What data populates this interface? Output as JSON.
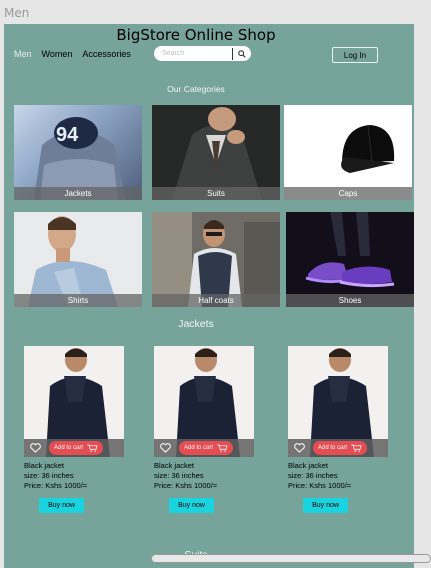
{
  "frame_label": "Men",
  "shop_title": "BigStore Online Shop",
  "nav": {
    "items": [
      "Men",
      "Women",
      "Accessories"
    ]
  },
  "search": {
    "placeholder": "Search"
  },
  "login_label": "Log In",
  "categories_title": "Our Categories",
  "categories": [
    "Jackets",
    "Suits",
    "Caps",
    "Shirts",
    "Half coats",
    "Shoes"
  ],
  "jackets_title": "Jackets",
  "products": [
    {
      "name": "Black jacket",
      "size": "size: 36 inches",
      "price": "Price: Kshs 1000/=",
      "cart_label": "Add to cart",
      "buy_label": "Buy now"
    },
    {
      "name": "Black jacket",
      "size": "size: 36 inches",
      "price": "Price: Kshs 1000/=",
      "cart_label": "Add to cart",
      "buy_label": "Buy now"
    },
    {
      "name": "Black jacket",
      "size": "size: 36 inches",
      "price": "Price: Kshs 1000/=",
      "cart_label": "Add to cart",
      "buy_label": "Buy now"
    }
  ],
  "suits_title": "Suits",
  "colors": {
    "page_bg": "#76a39a",
    "cart": "#e44d52",
    "buy": "#19d3df"
  }
}
